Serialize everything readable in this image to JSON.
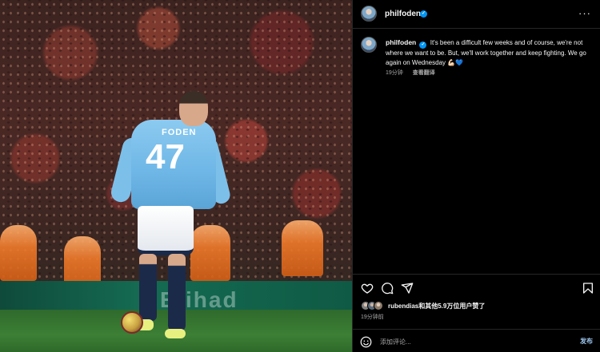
{
  "post": {
    "author": "philfoden",
    "caption": "It's been a difficult few weeks and of course, we're not where we want to be. But, we'll work together and keep fighting. We go again on Wednesday 💪🏻💙",
    "caption_time": "19分钟",
    "see_translation": "查看翻译",
    "likes_by": "rubendias",
    "likes_suffix": "和其他5.9万位用户赞了",
    "posted_time": "19分钟前"
  },
  "photo": {
    "jersey_name": "FODEN",
    "jersey_number": "47",
    "ad_text": "Etihad"
  },
  "comment": {
    "placeholder": "添加评论...",
    "post_label": "发布"
  },
  "colors": {
    "background": "#000000",
    "verified": "#0095f6",
    "post_button": "#9ec8f0",
    "secondary_text": "#a8a8a8"
  },
  "icons": [
    "verified-badge-icon",
    "more-icon",
    "heart-icon",
    "comment-icon",
    "share-icon",
    "bookmark-icon",
    "emoji-icon"
  ]
}
